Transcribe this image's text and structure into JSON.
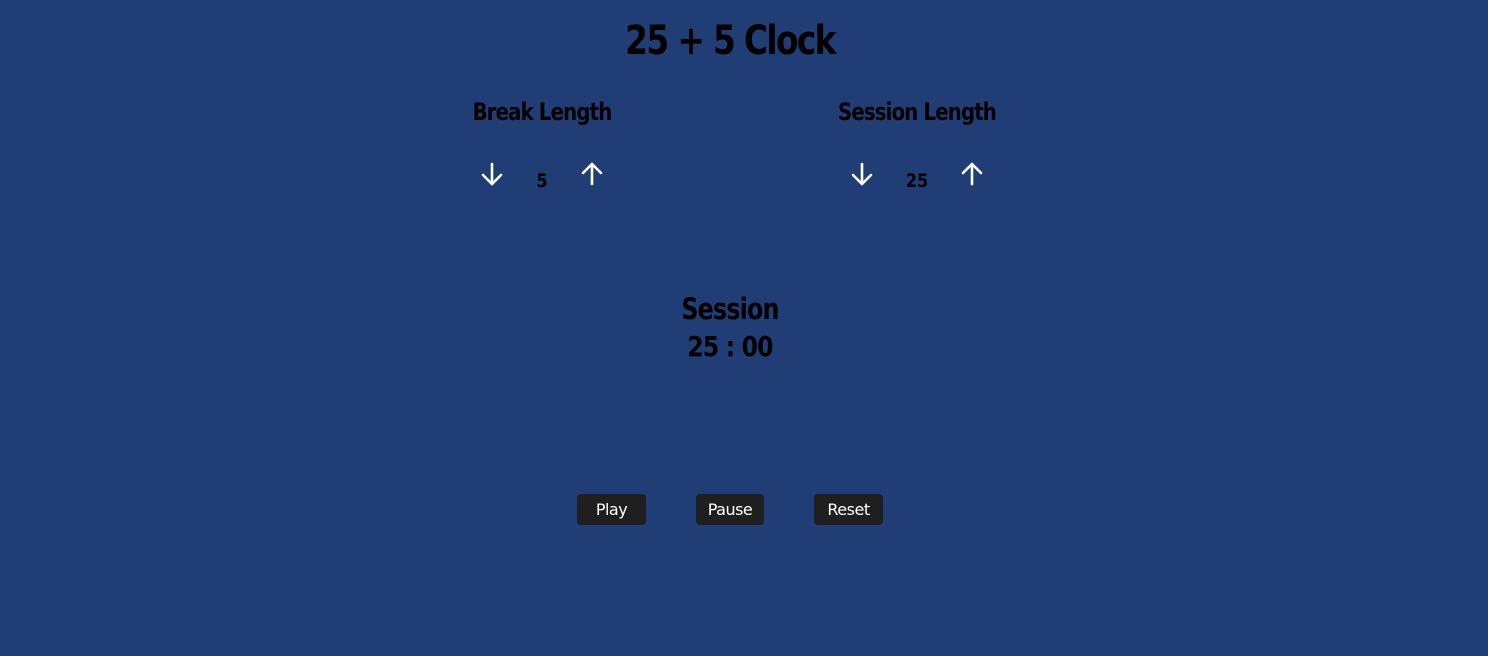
{
  "title": "25 + 5 Clock",
  "break": {
    "label": "Break Length",
    "value": "5",
    "decrement_icon": "arrow-down-icon",
    "increment_icon": "arrow-up-icon"
  },
  "session": {
    "label": "Session Length",
    "value": "25",
    "decrement_icon": "arrow-down-icon",
    "increment_icon": "arrow-up-icon"
  },
  "timer": {
    "label": "Session",
    "time": "25 : 00"
  },
  "buttons": {
    "play": "Play",
    "pause": "Pause",
    "reset": "Reset"
  },
  "colors": {
    "background": "#213d75",
    "text": "#000000",
    "arrow": "#ffffff",
    "button_bg": "#1f1f1f",
    "button_text": "#ffffff"
  }
}
